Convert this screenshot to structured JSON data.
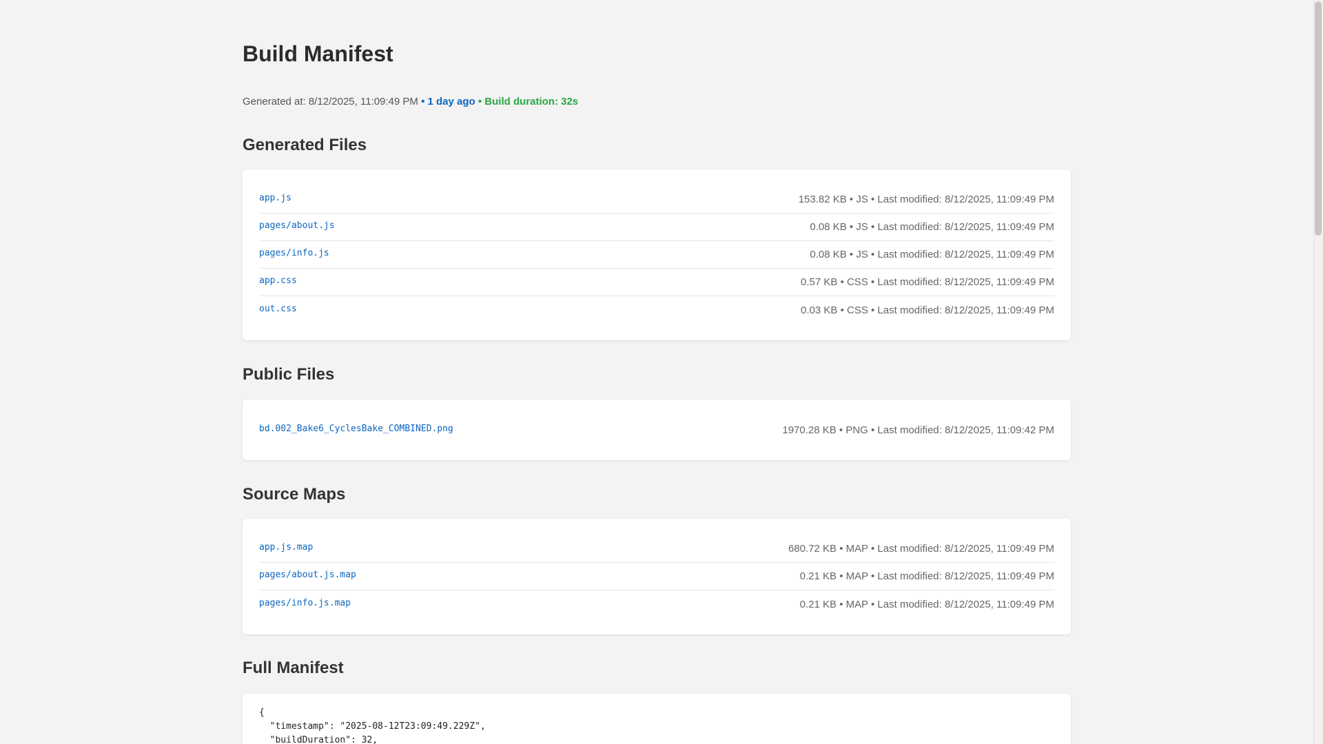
{
  "page": {
    "title": "Build Manifest",
    "meta": {
      "generated_at": "Generated at: 8/12/2025, 11:09:49 PM",
      "sep1": " • ",
      "ago": "1 day ago",
      "sep2": " • ",
      "duration": "Build duration: 32s"
    }
  },
  "sections": {
    "generated": {
      "title": "Generated Files",
      "files": [
        {
          "name": "app.js",
          "info": "153.82 KB • JS • Last modified: 8/12/2025, 11:09:49 PM"
        },
        {
          "name": "pages/about.js",
          "info": "0.08 KB • JS • Last modified: 8/12/2025, 11:09:49 PM"
        },
        {
          "name": "pages/info.js",
          "info": "0.08 KB • JS • Last modified: 8/12/2025, 11:09:49 PM"
        },
        {
          "name": "app.css",
          "info": "0.57 KB • CSS • Last modified: 8/12/2025, 11:09:49 PM"
        },
        {
          "name": "out.css",
          "info": "0.03 KB • CSS • Last modified: 8/12/2025, 11:09:49 PM"
        }
      ]
    },
    "public": {
      "title": "Public Files",
      "files": [
        {
          "name": "bd.002_Bake6_CyclesBake_COMBINED.png",
          "info": "1970.28 KB • PNG • Last modified: 8/12/2025, 11:09:42 PM"
        }
      ]
    },
    "sourcemaps": {
      "title": "Source Maps",
      "files": [
        {
          "name": "app.js.map",
          "info": "680.72 KB • MAP • Last modified: 8/12/2025, 11:09:49 PM"
        },
        {
          "name": "pages/about.js.map",
          "info": "0.21 KB • MAP • Last modified: 8/12/2025, 11:09:49 PM"
        },
        {
          "name": "pages/info.js.map",
          "info": "0.21 KB • MAP • Last modified: 8/12/2025, 11:09:49 PM"
        }
      ]
    },
    "manifest": {
      "title": "Full Manifest",
      "code": "{\n  \"timestamp\": \"2025-08-12T23:09:49.229Z\",\n  \"buildDuration\": 32,"
    }
  },
  "colors": {
    "link": "#0a66c2",
    "success": "#28a745",
    "background": "#f3f3f3",
    "card": "#ffffff"
  }
}
